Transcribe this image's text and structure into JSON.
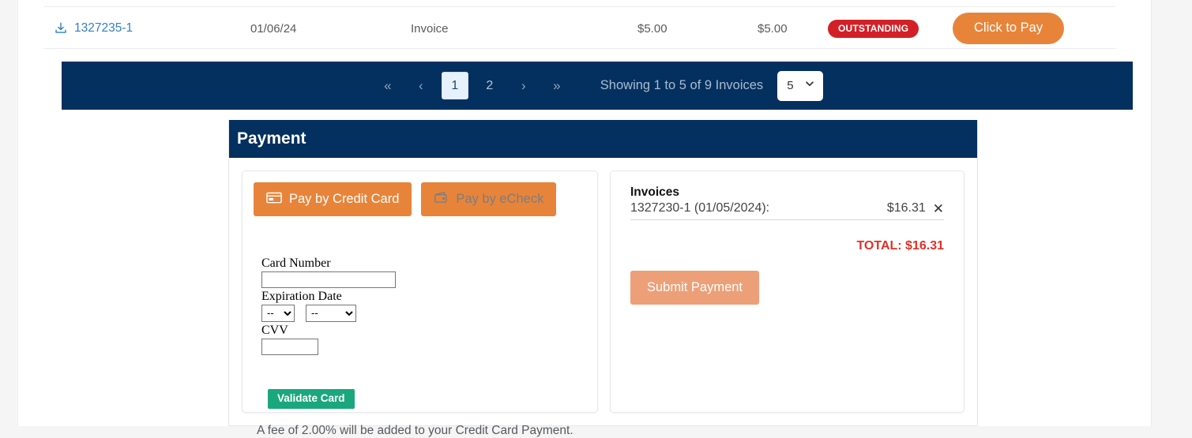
{
  "colors": {
    "navy": "#04305f",
    "orange": "#e8843a",
    "orange_muted": "#eda078",
    "red": "#d32027",
    "total_red": "#e03127",
    "teal": "#1aa77d",
    "link_blue": "#2f80c8"
  },
  "invoice_table": {
    "rows": [
      {
        "download_icon": "download-icon",
        "invoice_number": "1327235-1",
        "date": "01/06/24",
        "type": "Invoice",
        "amount": "$5.00",
        "balance": "$5.00",
        "status": "OUTSTANDING",
        "action_label": "Click to Pay"
      }
    ]
  },
  "pagination": {
    "first_icon": "«",
    "prev_icon": "‹",
    "pages": [
      {
        "label": "1",
        "active": true
      },
      {
        "label": "2",
        "active": false
      }
    ],
    "next_icon": "›",
    "last_icon": "»",
    "showing_text": "Showing 1 to 5 of 9 Invoices",
    "page_size": "5"
  },
  "payment": {
    "header_title": "Payment",
    "tabs": [
      {
        "label": "Pay by Credit Card",
        "icon": "credit-card-icon",
        "active": true
      },
      {
        "label": "Pay by eCheck",
        "icon": "wallet-icon",
        "active": false
      }
    ],
    "form": {
      "card_number_label": "Card Number",
      "card_number_value": "",
      "expiration_label": "Expiration Date",
      "exp_month_value": "--",
      "exp_year_value": "--",
      "cvv_label": "CVV",
      "cvv_value": "",
      "validate_label": "Validate Card",
      "fee_note": "A fee of 2.00% will be added to your Credit Card Payment."
    },
    "invoices_panel": {
      "heading": "Invoices",
      "lines": [
        {
          "label": "1327230-1 (01/05/2024):",
          "amount": "$16.31",
          "remove_icon": "✕"
        }
      ],
      "total_label": "TOTAL: $16.31",
      "submit_label": "Submit Payment"
    }
  }
}
